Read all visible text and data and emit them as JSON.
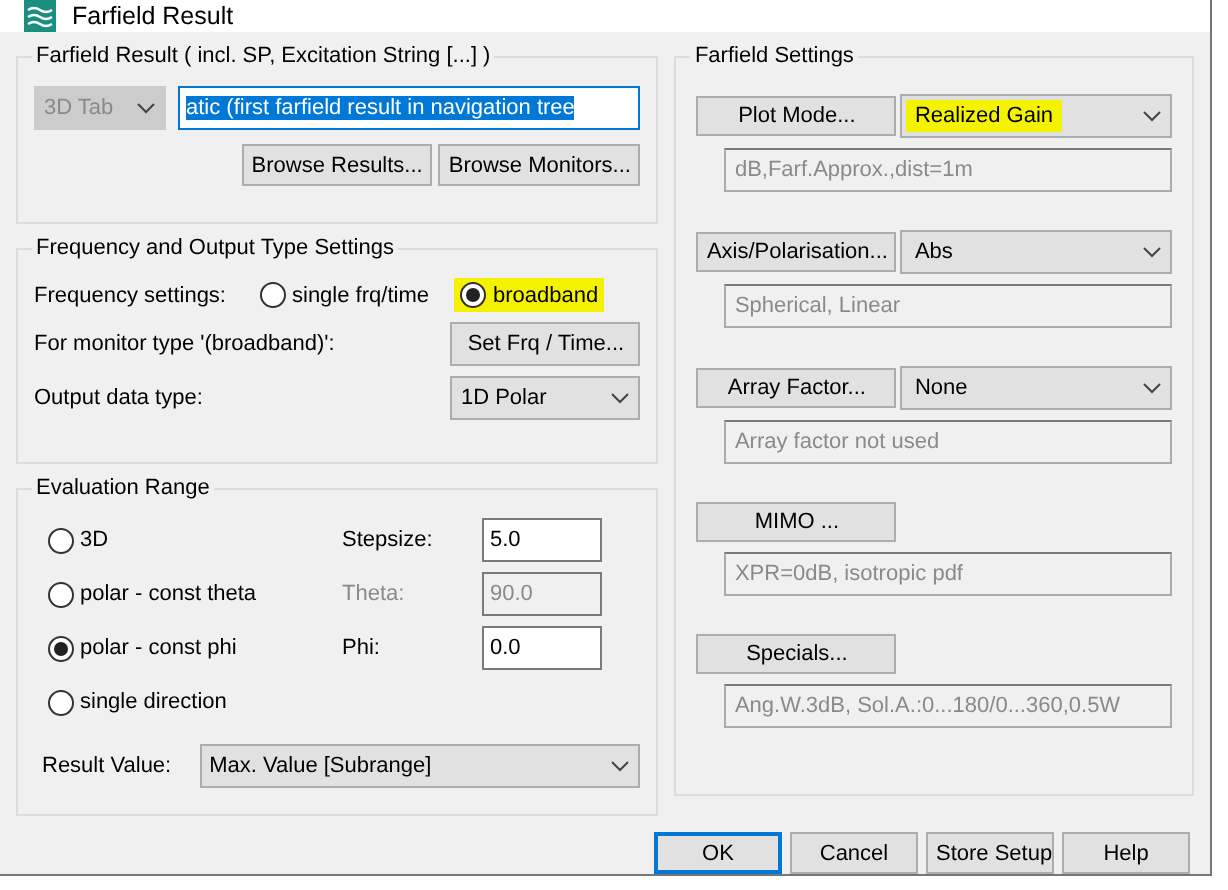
{
  "window": {
    "title": "Farfield Result"
  },
  "farfield_result": {
    "legend": "Farfield Result ( incl. SP, Excitation String [...] )",
    "tab_select": {
      "value": "3D Tab",
      "disabled": true
    },
    "result_field": {
      "value": "atic (first farfield result in navigation tree",
      "selected": true
    },
    "buttons": [
      "Browse Results...",
      "Browse Monitors..."
    ]
  },
  "frequency": {
    "legend": "Frequency and Output Type Settings",
    "frequency_label": "Frequency settings:",
    "options": [
      {
        "label": "single frq/time",
        "selected": false,
        "highlighted": false
      },
      {
        "label": "broadband",
        "selected": true,
        "highlighted": true
      }
    ],
    "monitor_label": "For monitor type '(broadband)':",
    "monitor_button": "Set Frq / Time...",
    "output_label": "Output data type:",
    "output_select": "1D Polar"
  },
  "evaluation": {
    "legend": "Evaluation Range",
    "options": [
      {
        "label": "3D",
        "selected": false
      },
      {
        "label": "polar - const theta",
        "selected": false
      },
      {
        "label": "polar - const phi",
        "selected": true
      },
      {
        "label": "single direction",
        "selected": false
      }
    ],
    "fields": [
      {
        "label": "Stepsize:",
        "value": "5.0",
        "disabled": false
      },
      {
        "label": "Theta:",
        "value": "90.0",
        "disabled": true
      },
      {
        "label": "Phi:",
        "value": "0.0",
        "disabled": false
      }
    ],
    "result_label": "Result Value:",
    "result_select": "Max. Value [Subrange]"
  },
  "farfield_settings": {
    "legend": "Farfield Settings",
    "sections": [
      {
        "kind": "select",
        "button": "Plot Mode...",
        "select": "Realized Gain",
        "highlighted": true,
        "summary": "dB,Farf.Approx.,dist=1m"
      },
      {
        "kind": "select",
        "button": "Axis/Polarisation...",
        "select": "Abs",
        "highlighted": false,
        "summary": "Spherical, Linear"
      },
      {
        "kind": "select",
        "button": "Array Factor...",
        "select": "None",
        "highlighted": false,
        "summary": "Array factor not used"
      },
      {
        "kind": "button",
        "button": "MIMO ...",
        "summary": "XPR=0dB, isotropic pdf"
      },
      {
        "kind": "button",
        "button": "Specials...",
        "summary": "Ang.W.3dB, Sol.A.:0...180/0...360,0.5W"
      }
    ]
  },
  "buttons": [
    {
      "label": "OK",
      "default": true
    },
    {
      "label": "Cancel",
      "default": false
    },
    {
      "label": "Store Setup",
      "default": false
    },
    {
      "label": "Help",
      "default": false
    }
  ]
}
